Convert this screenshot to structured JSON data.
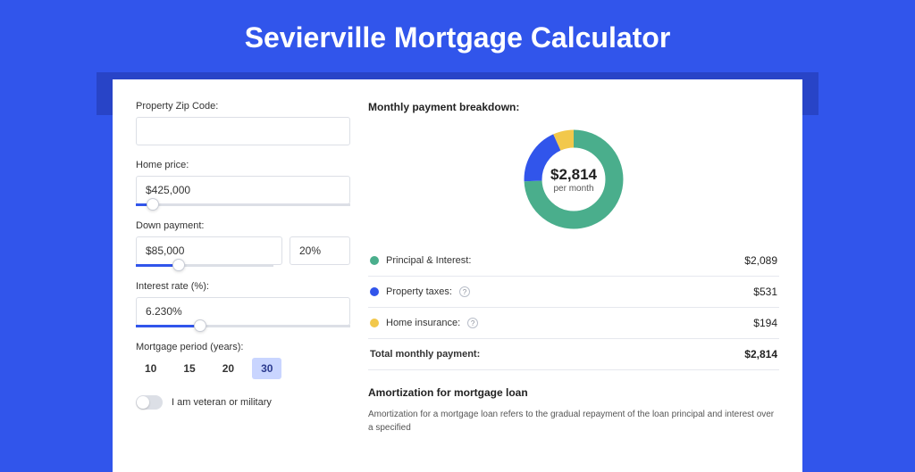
{
  "page": {
    "title": "Sevierville Mortgage Calculator"
  },
  "colors": {
    "primary": "#3155eb",
    "green": "#4aae8c",
    "yellow": "#f2c84b"
  },
  "form": {
    "zip": {
      "label": "Property Zip Code:",
      "value": ""
    },
    "home_price": {
      "label": "Home price:",
      "value": "$425,000",
      "slider_pct": 8
    },
    "down_payment": {
      "label": "Down payment:",
      "value": "$85,000",
      "pct_value": "20%",
      "slider_pct": 20
    },
    "interest_rate": {
      "label": "Interest rate (%):",
      "value": "6.230%",
      "slider_pct": 30
    },
    "mortgage_period": {
      "label": "Mortgage period (years):",
      "options": [
        "10",
        "15",
        "20",
        "30"
      ],
      "selected": "30"
    },
    "veteran": {
      "label": "I am veteran or military",
      "on": false
    }
  },
  "breakdown": {
    "title": "Monthly payment breakdown:",
    "center_amount": "$2,814",
    "center_sub": "per month",
    "items": [
      {
        "label": "Principal & Interest:",
        "value": "$2,089",
        "color": "green",
        "help": false
      },
      {
        "label": "Property taxes:",
        "value": "$531",
        "color": "blue",
        "help": true
      },
      {
        "label": "Home insurance:",
        "value": "$194",
        "color": "yellow",
        "help": true
      }
    ],
    "total": {
      "label": "Total monthly payment:",
      "value": "$2,814"
    }
  },
  "chart_data": {
    "type": "pie",
    "title": "Monthly payment breakdown",
    "series": [
      {
        "name": "Principal & Interest",
        "value": 2089,
        "color": "#4aae8c"
      },
      {
        "name": "Property taxes",
        "value": 531,
        "color": "#3155eb"
      },
      {
        "name": "Home insurance",
        "value": 194,
        "color": "#f2c84b"
      }
    ],
    "total": 2814,
    "center_label": "$2,814 per month"
  },
  "amortization": {
    "title": "Amortization for mortgage loan",
    "text": "Amortization for a mortgage loan refers to the gradual repayment of the loan principal and interest over a specified"
  }
}
